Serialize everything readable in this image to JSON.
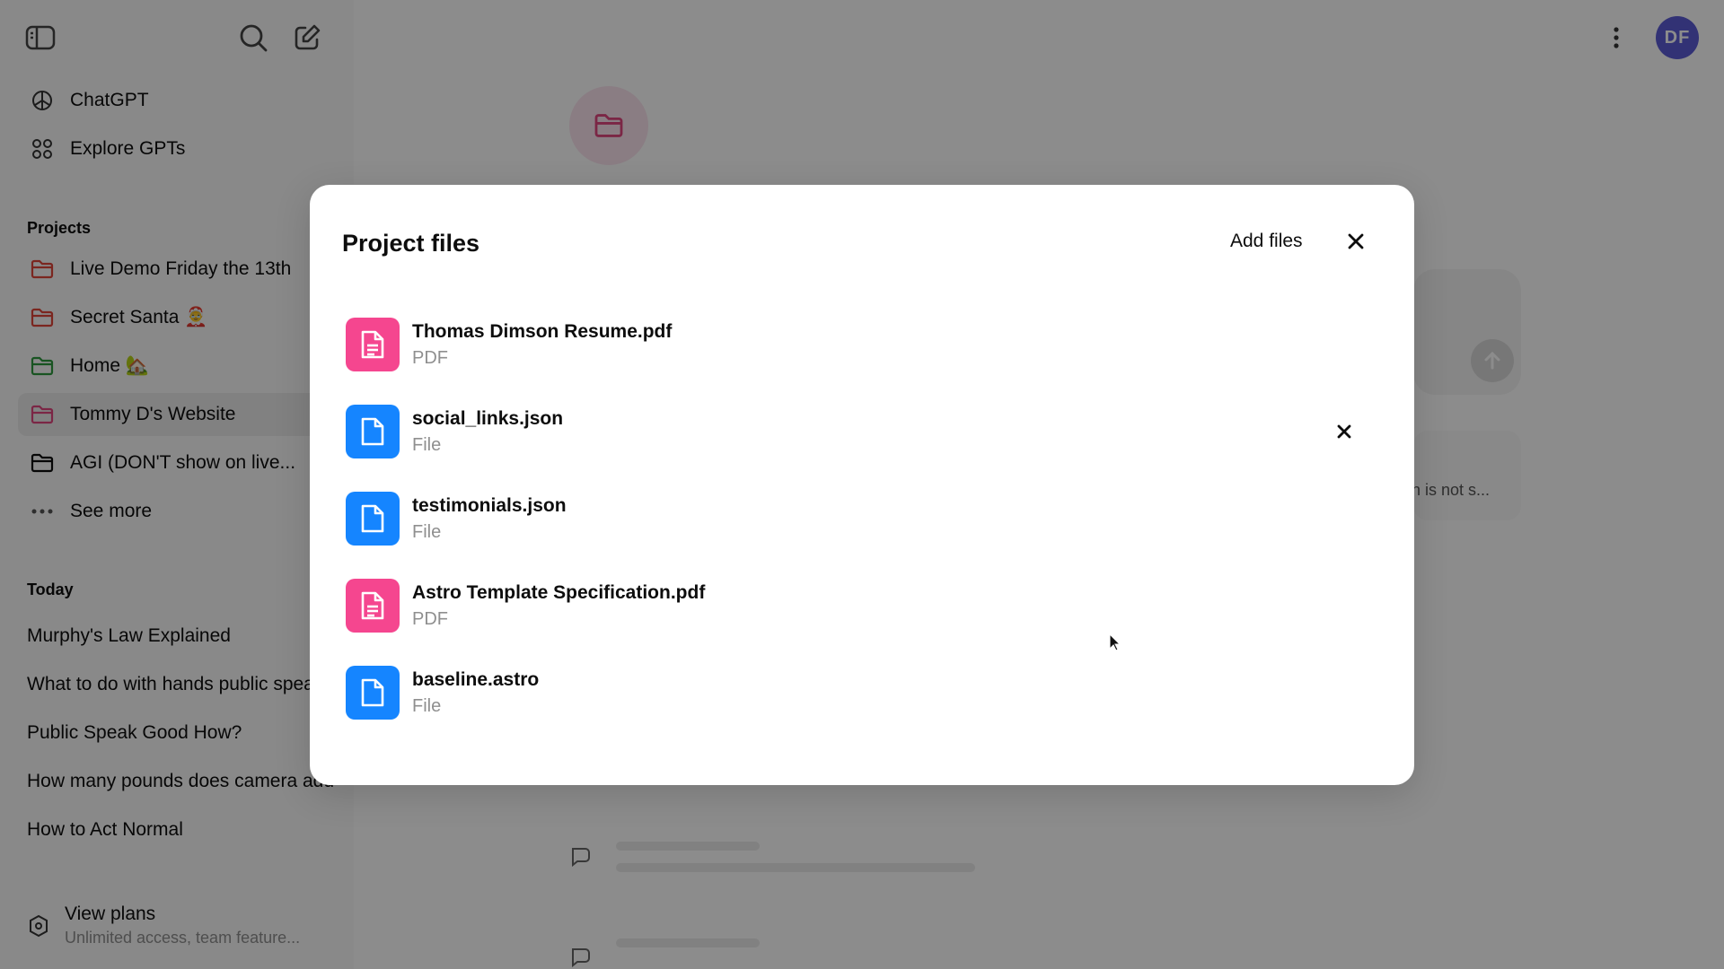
{
  "sidebar": {
    "nav": [
      {
        "label": "ChatGPT",
        "icon": "openai-logo-icon"
      },
      {
        "label": "Explore GPTs",
        "icon": "grid-icon"
      }
    ],
    "projects_heading": "Projects",
    "projects": [
      {
        "label": "Live Demo Friday the 13th",
        "color": "#e0453a"
      },
      {
        "label": "Secret Santa 🤶",
        "color": "#e0453a"
      },
      {
        "label": "Home 🏡",
        "color": "#2e9a3f"
      },
      {
        "label": "Tommy D's Website",
        "color": "#e0457f"
      },
      {
        "label": "AGI (DON'T show on live...",
        "color": "#0d0d0d"
      }
    ],
    "see_more": "See more",
    "today_heading": "Today",
    "chats": [
      "Murphy's Law Explained",
      "What to do with hands public speaking",
      "Public Speak Good How?",
      "How many pounds does camera add",
      "How to Act Normal"
    ],
    "upgrade": {
      "title": "View plans",
      "subtitle": "Unlimited access, team feature..."
    }
  },
  "header": {
    "avatar_initials": "DF"
  },
  "background": {
    "snippet": "h is not s..."
  },
  "modal": {
    "title": "Project files",
    "add_files_label": "Add files",
    "files": [
      {
        "name": "Thomas Dimson Resume.pdf",
        "type": "PDF",
        "kind": "pdf"
      },
      {
        "name": "social_links.json",
        "type": "File",
        "kind": "doc"
      },
      {
        "name": "testimonials.json",
        "type": "File",
        "kind": "doc"
      },
      {
        "name": "Astro Template Specification.pdf",
        "type": "PDF",
        "kind": "pdf"
      },
      {
        "name": "baseline.astro",
        "type": "File",
        "kind": "doc"
      }
    ]
  },
  "colors": {
    "pdf": "#f5468f",
    "file": "#1585ff",
    "avatar": "#5b5bd6"
  }
}
